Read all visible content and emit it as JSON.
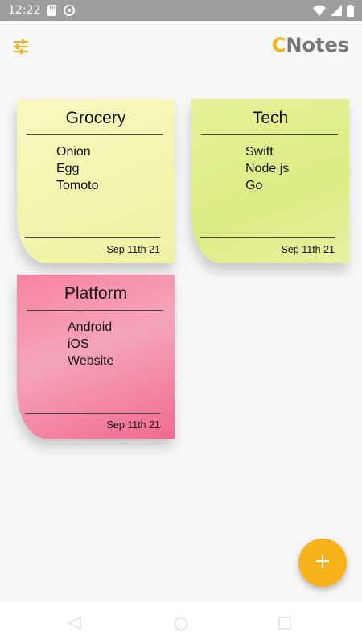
{
  "status_bar": {
    "time": "12:22",
    "left_icons": [
      "sd-card-icon",
      "data-saver-icon"
    ],
    "right_icons": [
      "wifi-icon",
      "signal-icon",
      "battery-icon"
    ]
  },
  "app_bar": {
    "title_accent": "C",
    "title_rest": "Notes",
    "filter_icon": "sliders-icon",
    "colors": {
      "accent": "#f6b21b",
      "title_gray": "#777777"
    }
  },
  "notes": [
    {
      "title": "Grocery",
      "items": [
        "Onion",
        "Egg",
        "Tomoto"
      ],
      "date": "Sep 11th 21",
      "color": "#f3f6b0"
    },
    {
      "title": "Tech",
      "items": [
        "Swift",
        "Node js",
        "Go"
      ],
      "date": "Sep 11th 21",
      "color": "#e0ec8a"
    },
    {
      "title": "Platform",
      "items": [
        "Android",
        "iOS",
        "Website"
      ],
      "date": "Sep 11th 21",
      "color": "#f48aa6"
    }
  ],
  "fab": {
    "icon": "plus-icon",
    "color": "#f7b21c"
  },
  "nav_bar": {
    "buttons": [
      "back-icon",
      "home-icon",
      "recents-icon"
    ]
  }
}
